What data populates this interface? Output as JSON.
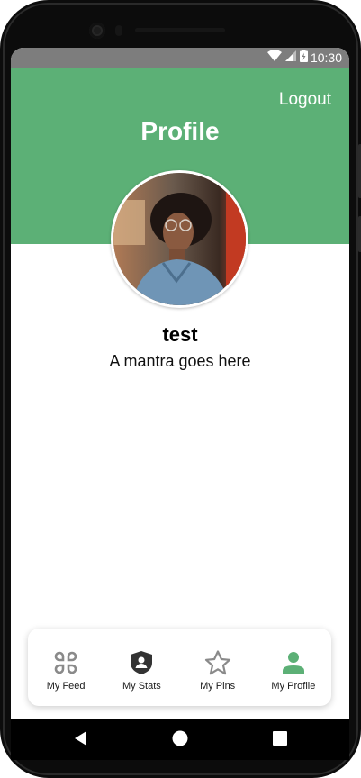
{
  "status_bar": {
    "time": "10:30"
  },
  "header": {
    "logout_label": "Logout",
    "title": "Profile"
  },
  "profile": {
    "username": "test",
    "mantra": "A mantra goes here"
  },
  "tabs": [
    {
      "label": "My Feed",
      "icon": "grid-icon",
      "active": false
    },
    {
      "label": "My Stats",
      "icon": "shield-user-icon",
      "active": false
    },
    {
      "label": "My Pins",
      "icon": "star-icon",
      "active": false
    },
    {
      "label": "My Profile",
      "icon": "person-icon",
      "active": true
    }
  ],
  "colors": {
    "header_green": "#5cb076",
    "active_tab": "#5cb076",
    "inactive_tab": "#8a8a8a",
    "status_bar": "#7d7d7d"
  }
}
